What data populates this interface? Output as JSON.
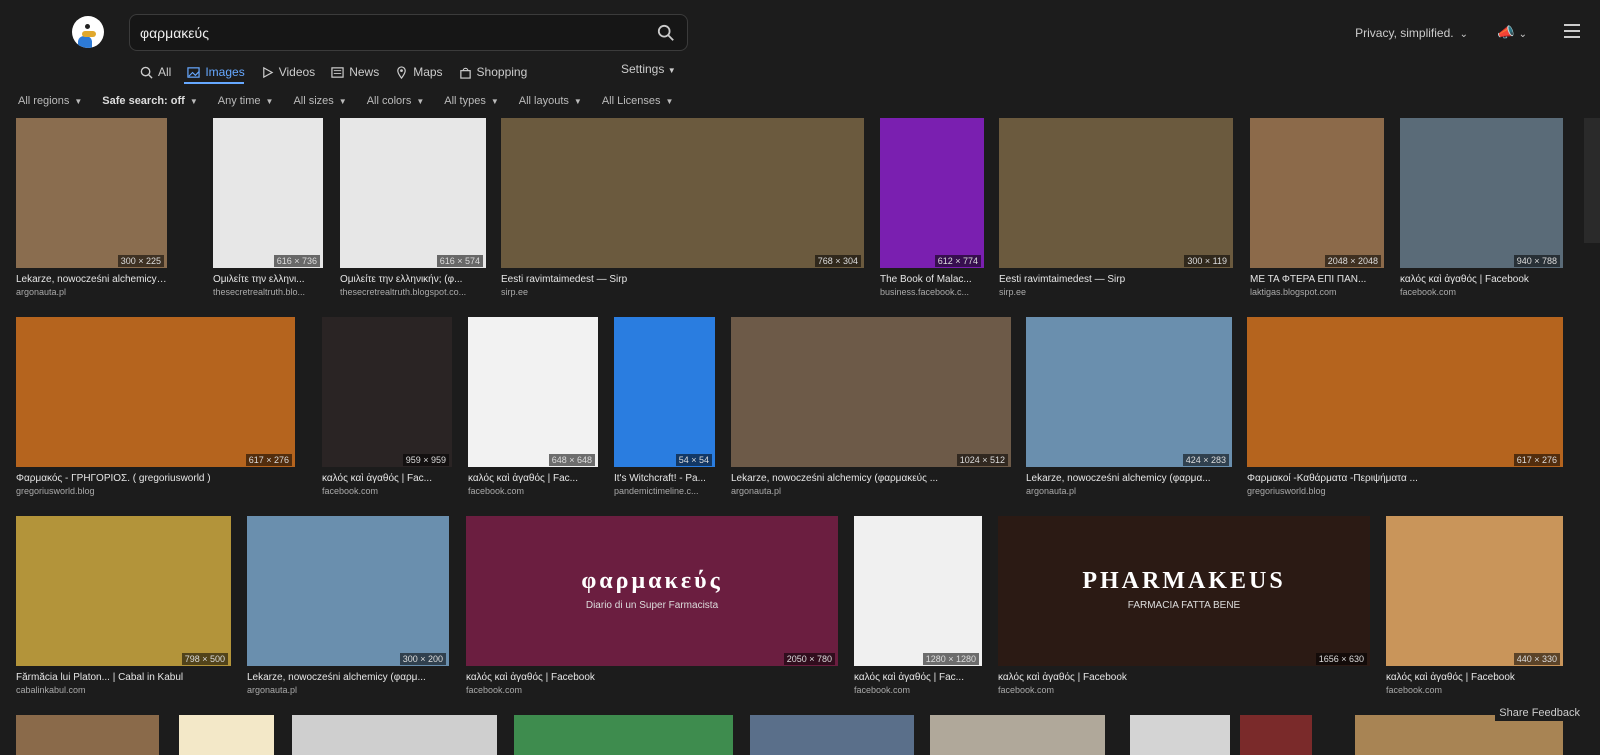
{
  "search": {
    "query": "φαρμακεύς"
  },
  "header": {
    "privacy_label": "Privacy, simplified."
  },
  "tabs": [
    {
      "label": "All",
      "icon": "search-icon"
    },
    {
      "label": "Images",
      "icon": "image-icon",
      "active": true
    },
    {
      "label": "Videos",
      "icon": "play-icon"
    },
    {
      "label": "News",
      "icon": "newspaper-icon"
    },
    {
      "label": "Maps",
      "icon": "pin-icon"
    },
    {
      "label": "Shopping",
      "icon": "bag-icon"
    }
  ],
  "settings_label": "Settings",
  "filters": [
    {
      "label": "All regions"
    },
    {
      "label": "Safe search: off",
      "bold": true
    },
    {
      "label": "Any time"
    },
    {
      "label": "All sizes"
    },
    {
      "label": "All colors"
    },
    {
      "label": "All types"
    },
    {
      "label": "All layouts"
    },
    {
      "label": "All Licenses"
    }
  ],
  "results": [
    {
      "title": "Lekarze, nowocześni alchemicy (φα...",
      "domain": "argonauta.pl",
      "dims": "300 × 225",
      "color": "#8a6d4f"
    },
    {
      "title": "Ομιλείτε την ελληνι...",
      "domain": "thesecretrealtruth.blo...",
      "dims": "616 × 736",
      "color": "#e7e7e7"
    },
    {
      "title": "Ομιλείτε την ελληνικήν; (φ...",
      "domain": "thesecretrealtruth.blogspot.co...",
      "dims": "616 × 574",
      "color": "#e7e7e7"
    },
    {
      "title": "Eesti ravimtaimedest — Sirp",
      "domain": "sirp.ee",
      "dims": "768 × 304",
      "color": "#6b5a3e"
    },
    {
      "title": "The Book of Malac...",
      "domain": "business.facebook.c...",
      "dims": "612 × 774",
      "color": "#7a1fb0"
    },
    {
      "title": "Eesti ravimtaimedest — Sirp",
      "domain": "sirp.ee",
      "dims": "300 × 119",
      "color": "#6b5a3e"
    },
    {
      "title": "ΜΕ ΤΑ ΦΤΕΡΑ ΕΠΙ ΠΑΝ...",
      "domain": "laktigas.blogspot.com",
      "dims": "2048 × 2048",
      "color": "#8c6a4a"
    },
    {
      "title": "καλός καὶ ἀγαθός | Facebook",
      "domain": "facebook.com",
      "dims": "940 × 788",
      "color": "#5a6b78"
    },
    {
      "title": "Φαρμακός - ΓΡΗΓΟΡΙΟΣ. ( gregoriusworld )",
      "domain": "gregoriusworld.blog",
      "dims": "617 × 276",
      "color": "#b5641e"
    },
    {
      "title": "καλός καὶ ἀγαθός | Fac...",
      "domain": "facebook.com",
      "dims": "959 × 959",
      "color": "#2a2424"
    },
    {
      "title": "καλός καὶ ἀγαθός | Fac...",
      "domain": "facebook.com",
      "dims": "648 × 648",
      "color": "#f2f2f2"
    },
    {
      "title": "It's Witchcraft! - Pa...",
      "domain": "pandemictimeline.c...",
      "dims": "54 × 54",
      "color": "#2a7de0"
    },
    {
      "title": "Lekarze, nowocześni alchemicy (φαρμακεύς ...",
      "domain": "argonauta.pl",
      "dims": "1024 × 512",
      "color": "#6d5a48"
    },
    {
      "title": "Lekarze, nowocześni alchemicy (φαρμα...",
      "domain": "argonauta.pl",
      "dims": "424 × 283",
      "color": "#6a8fae"
    },
    {
      "title": "Φαρμακοί -Καθάρματα -Περιψήματα ...",
      "domain": "gregoriusworld.blog",
      "dims": "617 × 276",
      "color": "#b5641e"
    },
    {
      "title": "Fărmăcia lui Platon... | Cabal in Kabul",
      "domain": "cabalinkabul.com",
      "dims": "798 × 500",
      "color": "#b3943a"
    },
    {
      "title": "Lekarze, nowocześni alchemicy (φαρμ...",
      "domain": "argonauta.pl",
      "dims": "300 × 200",
      "color": "#6a8fae"
    },
    {
      "title": "καλός καὶ ἀγαθός | Facebook",
      "domain": "facebook.com",
      "dims": "2050 × 780",
      "color": "#6b1e40",
      "inner_text": "φαρμακεύς",
      "inner_sub": "Diario di un Super Farmacista"
    },
    {
      "title": "καλός καὶ ἀγαθός | Fac...",
      "domain": "facebook.com",
      "dims": "1280 × 1280",
      "color": "#f0f0f0"
    },
    {
      "title": "καλός καὶ ἀγαθός | Facebook",
      "domain": "facebook.com",
      "dims": "1656 × 630",
      "color": "#2b1a14",
      "inner_text": "PHARMAKEUS",
      "inner_sub": "FARMACIA FATTA BENE"
    },
    {
      "title": "καλός καὶ ἀγαθός | Facebook",
      "domain": "facebook.com",
      "dims": "440 × 330",
      "color": "#c9955a"
    },
    {
      "color": "#8a6a4a"
    },
    {
      "color": "#f3e8c8"
    },
    {
      "color": "#cfcfcf"
    },
    {
      "color": "#3e8c4e"
    },
    {
      "color": "#5a6f8a"
    },
    {
      "color": "#b0a89a"
    },
    {
      "color": "#d4d4d4"
    },
    {
      "color": "#7a2a2a"
    },
    {
      "color": "#a88454"
    }
  ],
  "feedback_label": "Share Feedback"
}
